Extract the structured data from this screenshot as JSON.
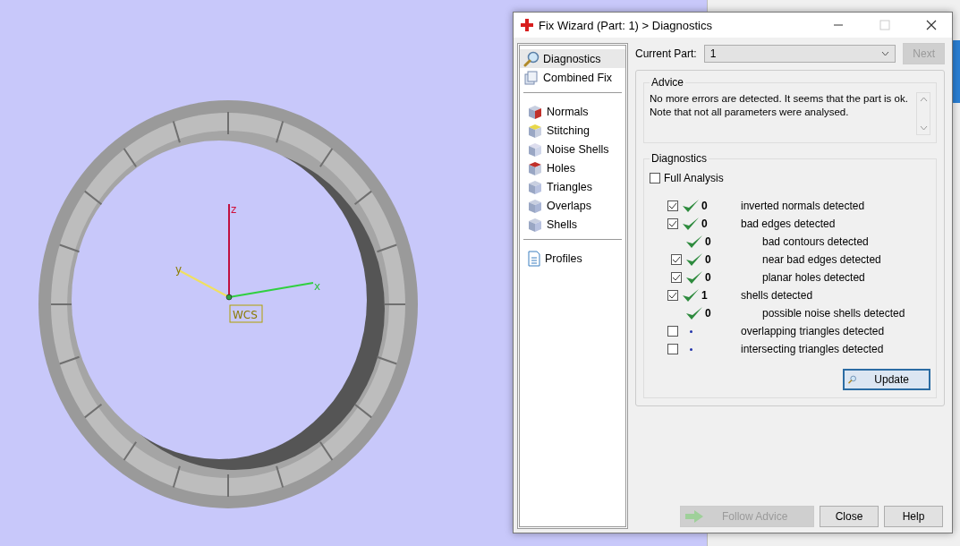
{
  "viewport": {
    "axes": {
      "z": "z",
      "x": "x",
      "y": "y",
      "origin": "WCS"
    }
  },
  "dialog": {
    "title": "Fix Wizard (Part: 1) > Diagnostics",
    "nav": {
      "groups": [
        [
          {
            "label": "Diagnostics",
            "selected": true
          },
          {
            "label": "Combined Fix",
            "selected": false
          }
        ],
        [
          {
            "label": "Normals",
            "selected": false
          },
          {
            "label": "Stitching",
            "selected": false
          },
          {
            "label": "Noise Shells",
            "selected": false
          },
          {
            "label": "Holes",
            "selected": false
          },
          {
            "label": "Triangles",
            "selected": false
          },
          {
            "label": "Overlaps",
            "selected": false
          },
          {
            "label": "Shells",
            "selected": false
          }
        ],
        [
          {
            "label": "Profiles",
            "selected": false
          }
        ]
      ]
    },
    "current_part": {
      "label": "Current Part:",
      "value": "1",
      "next": "Next",
      "next_disabled": true
    },
    "advice": {
      "title": "Advice",
      "text": "No more errors are detected. It seems that the part is ok.\nNote that not all parameters were analysed."
    },
    "diagnostics": {
      "title": "Diagnostics",
      "full_analysis": {
        "label": "Full Analysis",
        "checked": false
      },
      "items": [
        {
          "kind": "checkbox",
          "checked": true,
          "passed": true,
          "count": "0",
          "label": "inverted normals detected"
        },
        {
          "kind": "checkbox",
          "checked": true,
          "passed": true,
          "count": "0",
          "label": "bad edges detected",
          "children": [
            {
              "kind": "plain",
              "passed": true,
              "count": "0",
              "label": "bad contours detected"
            },
            {
              "kind": "checkbox",
              "checked": true,
              "passed": true,
              "count": "0",
              "label": "near bad edges detected"
            },
            {
              "kind": "checkbox",
              "checked": true,
              "passed": true,
              "count": "0",
              "label": "planar holes detected"
            }
          ]
        },
        {
          "kind": "checkbox",
          "checked": true,
          "passed": true,
          "count": "1",
          "label": "shells detected",
          "children": [
            {
              "kind": "plain",
              "passed": true,
              "count": "0",
              "label": "possible noise shells detected"
            }
          ]
        },
        {
          "kind": "checkbox",
          "checked": false,
          "passed": false,
          "label": "overlapping triangles detected"
        },
        {
          "kind": "checkbox",
          "checked": false,
          "passed": false,
          "label": "intersecting triangles detected"
        }
      ],
      "update": "Update"
    },
    "buttons": [
      {
        "label": "Follow Advice",
        "disabled": true
      },
      {
        "label": "Close",
        "disabled": false
      },
      {
        "label": "Help",
        "disabled": false
      }
    ]
  }
}
